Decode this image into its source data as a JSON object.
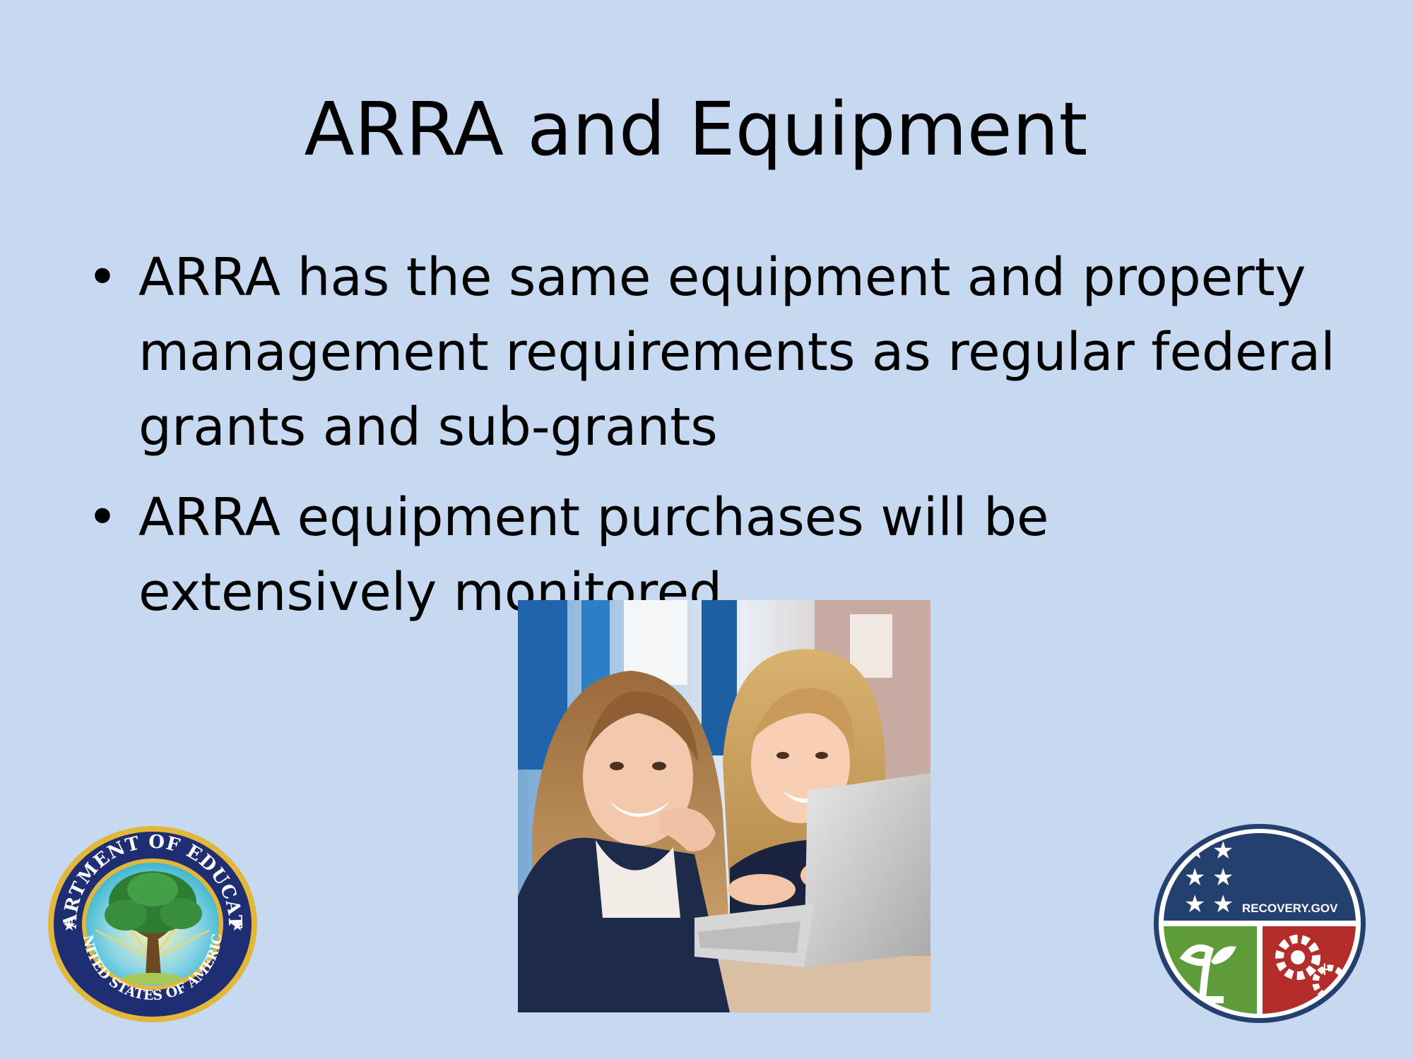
{
  "slide": {
    "title": "ARRA and Equipment",
    "bullets": [
      "ARRA has the same equipment and property management requirements as regular federal grants and sub-grants",
      "ARRA equipment purchases will be extensively monitored"
    ],
    "bullet_symbol": "•"
  },
  "seals": {
    "education_top_text": "DEPARTMENT OF EDUCATION",
    "education_bottom_text": "UNITED STATES OF AMERICA",
    "recovery_text": "RECOVERY.GOV"
  },
  "colors": {
    "background": "#c6d9f0",
    "recovery_navy": "#24406f",
    "recovery_green": "#5e9c3a",
    "recovery_red": "#b52d2b",
    "seal_gold": "#e2b73a",
    "seal_navy": "#1f2e73"
  },
  "images": {
    "photo_subject": "two girls using a laptop"
  }
}
